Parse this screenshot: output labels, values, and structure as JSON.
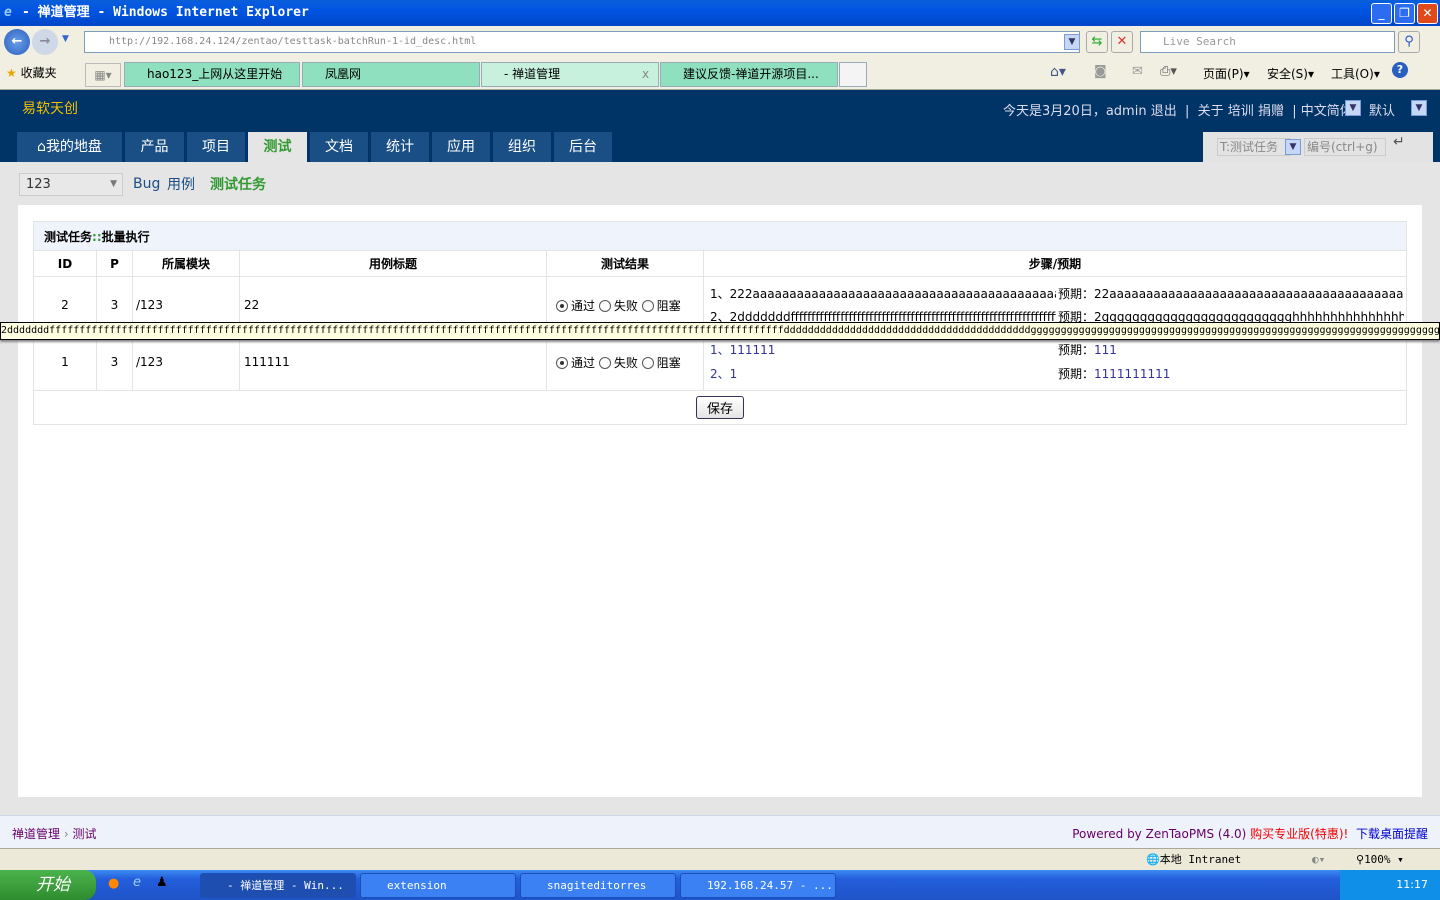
{
  "window": {
    "title": "- 禅道管理 - Windows Internet Explorer",
    "buttons": [
      "_",
      "❐",
      "✕"
    ]
  },
  "browser": {
    "url": "http://192.168.24.124/zentao/testtask-batchRun-1-id_desc.html",
    "search_placeholder": "Live Search",
    "favorites": "收藏夹",
    "tabs": [
      {
        "label": "hao123_上网从这里开始"
      },
      {
        "label": "凤凰网"
      },
      {
        "label": "- 禅道管理",
        "active": true
      },
      {
        "label": "建议反馈-禅道开源项目..."
      }
    ],
    "cmd": {
      "page": "页面(P)",
      "safety": "安全(S)",
      "tools": "工具(O)"
    }
  },
  "app": {
    "logo": "易软天创",
    "date": "今天是3月20日，",
    "user": "admin",
    "logout": "退出",
    "about": "关于",
    "training": "培训",
    "donate": "捐赠",
    "lang": "中文简体",
    "theme": "默认",
    "nav": [
      "我的地盘",
      "产品",
      "项目",
      "测试",
      "文档",
      "统计",
      "应用",
      "组织",
      "后台"
    ],
    "search_type": "T:测试任务",
    "search_placeholder": "编号(ctrl+g)"
  },
  "subnav": {
    "product": "123",
    "bug": "Bug",
    "case": "用例",
    "testtask": "测试任务"
  },
  "panel": {
    "title_a": "测试任务",
    "title_sep": "::",
    "title_b": "批量执行",
    "headers": [
      "ID",
      "P",
      "所属模块",
      "用例标题",
      "测试结果",
      "步骤/预期"
    ],
    "results": [
      "通过",
      "失败",
      "阻塞"
    ],
    "expect_label": "预期：",
    "rows": [
      {
        "id": "2",
        "p": "3",
        "module": "/123",
        "title": "22",
        "result": "通过",
        "steps": [
          {
            "step": "1、222aaaaaaaaaaaaaaaaaaaaaaaaaaaaaaaaaaaaaaaaaaaaaaaaa",
            "expect": "22aaaaaaaaaaaaaaaaaaaaaaaaaaaaaaaaaaaaaaaaaaaaaaa"
          },
          {
            "step": "2、2dddddddffffffffffffffffffffffffffffffffffffffffffffffffffffffffffffffffffffff",
            "expect": "2ggggggggggggggggggggggggghhhhhhhhhhhhhhhhhh"
          }
        ]
      },
      {
        "id": "1",
        "p": "3",
        "module": "/123",
        "title": "111111",
        "result": "通过",
        "steps": [
          {
            "step": "1、111111",
            "expect": "111"
          },
          {
            "step": "2、1",
            "expect": "1111111111"
          }
        ]
      }
    ],
    "save": "保存",
    "tooltip": "2dddddddffffffffffffffffffffffffffffffffffffffffffffffffffffffffffffffffffffffffffffffffffffffffffffffffffffffffffffffffffffffffffdddddddddddddddddddddddddddddddddddddddddggggggggggggggggggggggggggggggggggggggggggggggggggggggggggggggggggggggggggggggggggggggggggg"
  },
  "footer": {
    "crumb1": "禅道管理",
    "crumb2": "测试",
    "powered": "Powered by ",
    "product": "ZenTaoPMS",
    "version": " (4.0) ",
    "buy": "购买专业版(特惠)!",
    "download": "下载桌面提醒"
  },
  "statusbar": {
    "zone": "本地 Intranet",
    "zoom": "100%"
  },
  "taskbar": {
    "start": "开始",
    "tasks": [
      "- 禅道管理 - Win...",
      "extension",
      "snagiteditorres",
      "192.168.24.57 - ..."
    ],
    "clock": "11:17"
  }
}
